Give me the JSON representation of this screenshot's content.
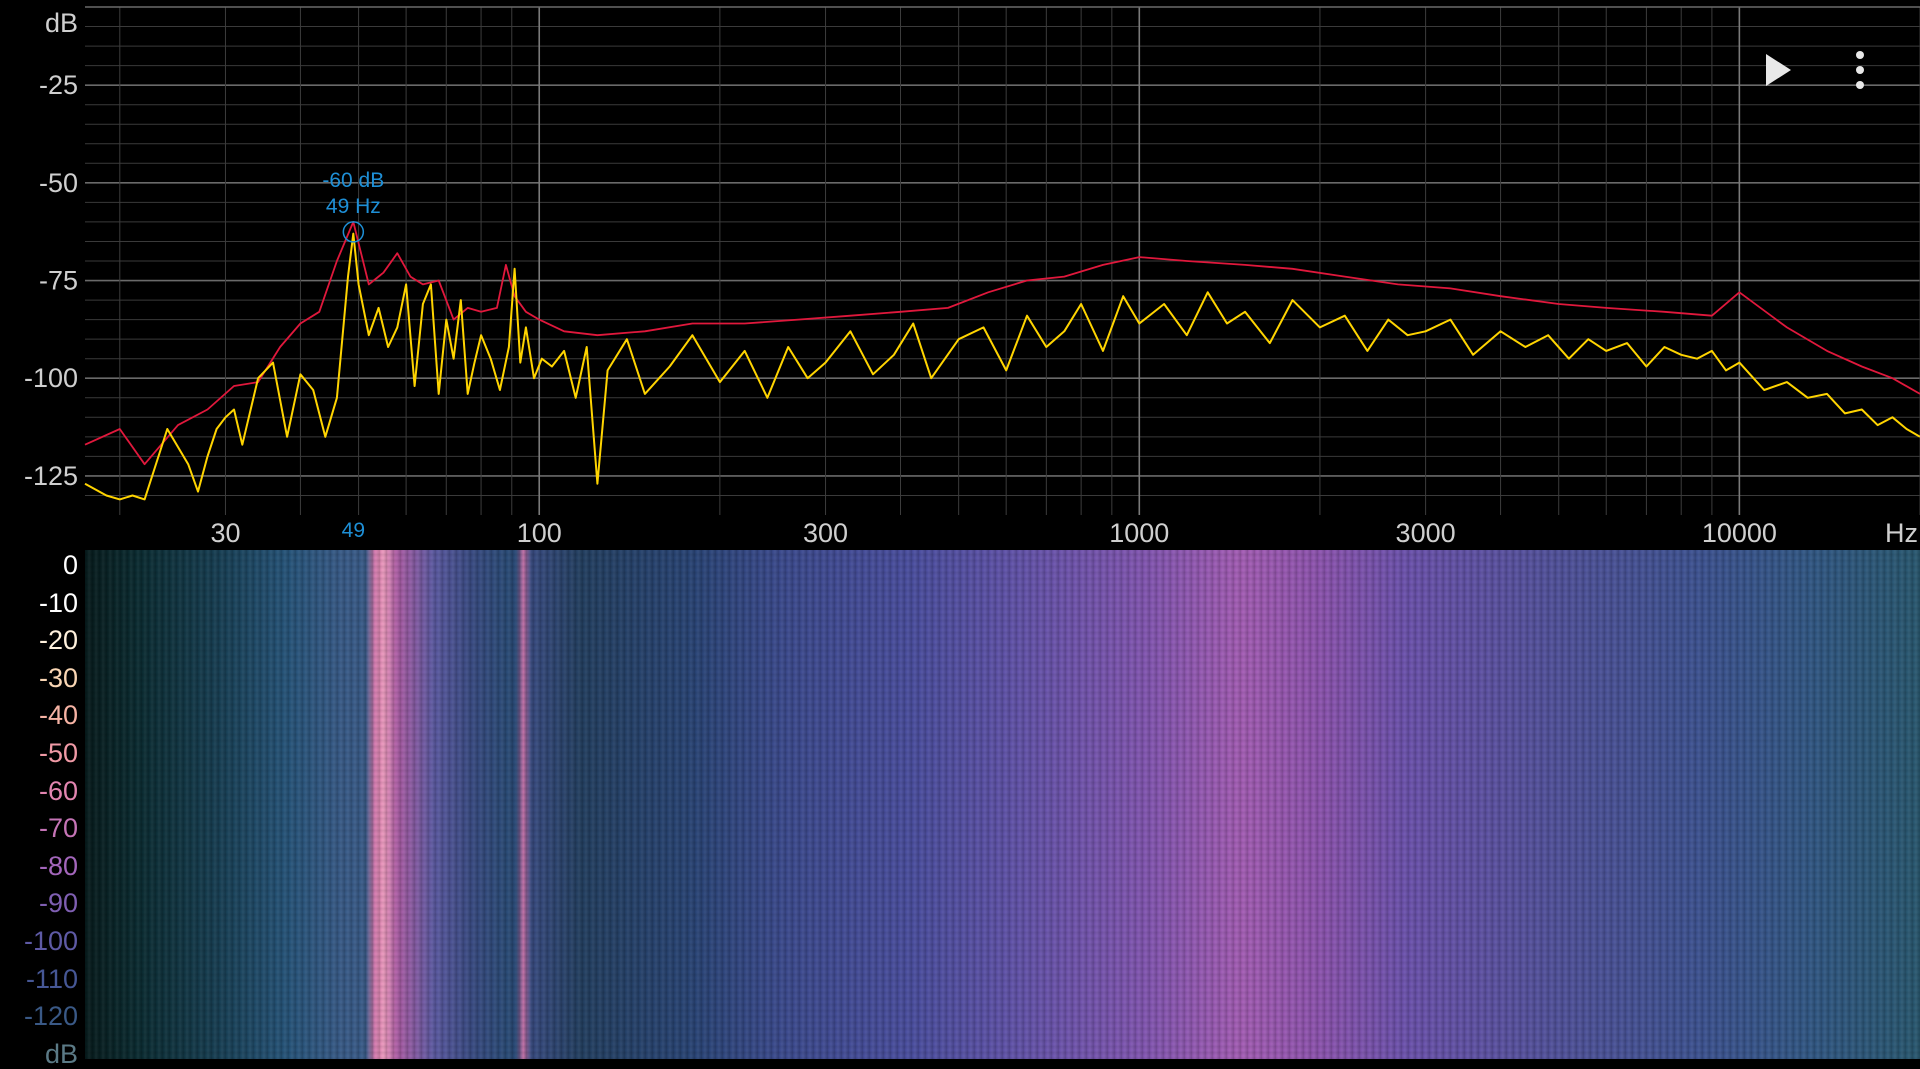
{
  "spectrum": {
    "y_unit": "dB",
    "x_unit": "Hz",
    "y_ticks": [
      "-25",
      "-50",
      "-75",
      "-100",
      "-125"
    ],
    "x_ticks": [
      "30",
      "100",
      "300",
      "1000",
      "3000",
      "10000"
    ],
    "peak_marker": {
      "level": "-60 dB",
      "freq": "49 Hz",
      "axis_label": "49",
      "color": "#1e8fd6"
    },
    "colors": {
      "live": "#ffd400",
      "peak_hold": "#e0183c",
      "grid": "#555555",
      "axis_text": "#cfcfcf"
    }
  },
  "chart_data": {
    "type": "line",
    "title": "",
    "xlabel": "Hz",
    "ylabel": "dB",
    "x_scale": "log",
    "xlim": [
      17.5,
      20000
    ],
    "ylim": [
      -135,
      -5
    ],
    "grid": true,
    "series": [
      {
        "color": "#e0183c",
        "x": [
          17.5,
          20,
          22,
          25,
          28,
          31,
          34,
          37,
          40,
          43,
          46,
          49,
          52,
          55,
          58,
          61,
          64,
          68,
          72,
          76,
          80,
          85,
          88,
          91,
          95,
          100,
          110,
          125,
          150,
          180,
          220,
          270,
          330,
          400,
          480,
          560,
          650,
          750,
          870,
          1000,
          1200,
          1500,
          1800,
          2200,
          2700,
          3300,
          4000,
          5000,
          6000,
          7500,
          9000,
          10000,
          12000,
          14000,
          16000,
          18000,
          20000
        ],
        "y": [
          -117,
          -113,
          -122,
          -112,
          -108,
          -102,
          -101,
          -92,
          -86,
          -83,
          -70,
          -60,
          -76,
          -73,
          -68,
          -74,
          -76,
          -75,
          -85,
          -82,
          -83,
          -82,
          -71,
          -79,
          -83,
          -85,
          -88,
          -89,
          -88,
          -86,
          -86,
          -85,
          -84,
          -83,
          -82,
          -78,
          -75,
          -74,
          -71,
          -69,
          -70,
          -71,
          -72,
          -74,
          -76,
          -77,
          -79,
          -81,
          -82,
          -83,
          -84,
          -78,
          -87,
          -93,
          -97,
          -100,
          -104
        ]
      },
      {
        "color": "#ffd400",
        "x": [
          17.5,
          19,
          20,
          21,
          22,
          24,
          26,
          27,
          28,
          29,
          30,
          31,
          32,
          34,
          36,
          38,
          40,
          42,
          44,
          46,
          48,
          49,
          50,
          52,
          54,
          56,
          58,
          60,
          62,
          64,
          66,
          68,
          70,
          72,
          74,
          76,
          78,
          80,
          83,
          86,
          89,
          91,
          93,
          95,
          98,
          101,
          105,
          110,
          115,
          120,
          125,
          130,
          140,
          150,
          165,
          180,
          200,
          220,
          240,
          260,
          280,
          300,
          330,
          360,
          390,
          420,
          450,
          500,
          550,
          600,
          650,
          700,
          750,
          800,
          870,
          940,
          1000,
          1100,
          1200,
          1300,
          1400,
          1500,
          1650,
          1800,
          2000,
          2200,
          2400,
          2600,
          2800,
          3000,
          3300,
          3600,
          4000,
          4400,
          4800,
          5200,
          5600,
          6000,
          6500,
          7000,
          7500,
          8000,
          8500,
          9000,
          9500,
          10000,
          11000,
          12000,
          13000,
          14000,
          15000,
          16000,
          17000,
          18000,
          19000,
          20000
        ],
        "y": [
          -127,
          -130,
          -131,
          -130,
          -131,
          -113,
          -122,
          -129,
          -120,
          -113,
          -110,
          -108,
          -117,
          -100,
          -96,
          -115,
          -99,
          -103,
          -115,
          -105,
          -74,
          -63,
          -76,
          -89,
          -82,
          -92,
          -87,
          -76,
          -102,
          -81,
          -76,
          -104,
          -85,
          -95,
          -80,
          -104,
          -96,
          -89,
          -95,
          -103,
          -92,
          -72,
          -96,
          -87,
          -100,
          -95,
          -97,
          -93,
          -105,
          -92,
          -127,
          -98,
          -90,
          -104,
          -97,
          -89,
          -101,
          -93,
          -105,
          -92,
          -100,
          -96,
          -88,
          -99,
          -94,
          -86,
          -100,
          -90,
          -87,
          -98,
          -84,
          -92,
          -88,
          -81,
          -93,
          -79,
          -86,
          -81,
          -89,
          -78,
          -86,
          -83,
          -91,
          -80,
          -87,
          -84,
          -93,
          -85,
          -89,
          -88,
          -85,
          -94,
          -88,
          -92,
          -89,
          -95,
          -90,
          -93,
          -91,
          -97,
          -92,
          -94,
          -95,
          -93,
          -98,
          -96,
          -103,
          -101,
          -105,
          -104,
          -109,
          -108,
          -112,
          -110,
          -113,
          -115
        ]
      }
    ]
  },
  "spectrogram": {
    "scale_labels": [
      "0",
      "-10",
      "-20",
      "-30",
      "-40",
      "-50",
      "-60",
      "-70",
      "-80",
      "-90",
      "-100",
      "-110",
      "-120",
      "dB"
    ],
    "scale_colors": [
      "#ffffff",
      "#ffffff",
      "#fff1dd",
      "#f9d6b4",
      "#f6b3a4",
      "#f09aa6",
      "#e285b0",
      "#c574b6",
      "#a366bb",
      "#7f5fb2",
      "#5e5aa5",
      "#465795",
      "#3a5986",
      "#5b7a86"
    ]
  },
  "toolbar": {
    "play_icon": "play-icon",
    "menu_icon": "more-vert-icon"
  }
}
